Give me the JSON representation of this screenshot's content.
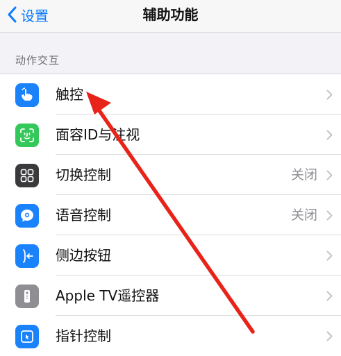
{
  "nav": {
    "back_label": "设置",
    "title": "辅助功能"
  },
  "section": {
    "header": "动作交互"
  },
  "rows": [
    {
      "label": "触控",
      "value": "",
      "icon": "hand-touch-icon",
      "icon_color": "#1a82fb"
    },
    {
      "label": "面容ID与注视",
      "value": "",
      "icon": "face-id-icon",
      "icon_color": "#34c759"
    },
    {
      "label": "切换控制",
      "value": "关闭",
      "icon": "switch-control-grid-icon",
      "icon_color": "#3a3a3c"
    },
    {
      "label": "语音控制",
      "value": "关闭",
      "icon": "voice-control-icon",
      "icon_color": "#1a82fb"
    },
    {
      "label": "侧边按钮",
      "value": "",
      "icon": "side-button-icon",
      "icon_color": "#1a82fb"
    },
    {
      "label": "Apple TV遥控器",
      "value": "",
      "icon": "tv-remote-icon",
      "icon_color": "#8e8e93"
    },
    {
      "label": "指针控制",
      "value": "",
      "icon": "pointer-control-icon",
      "icon_color": "#1a82fb"
    }
  ],
  "colors": {
    "accent": "#0a7aff",
    "annotation_arrow": "#e8231a"
  }
}
